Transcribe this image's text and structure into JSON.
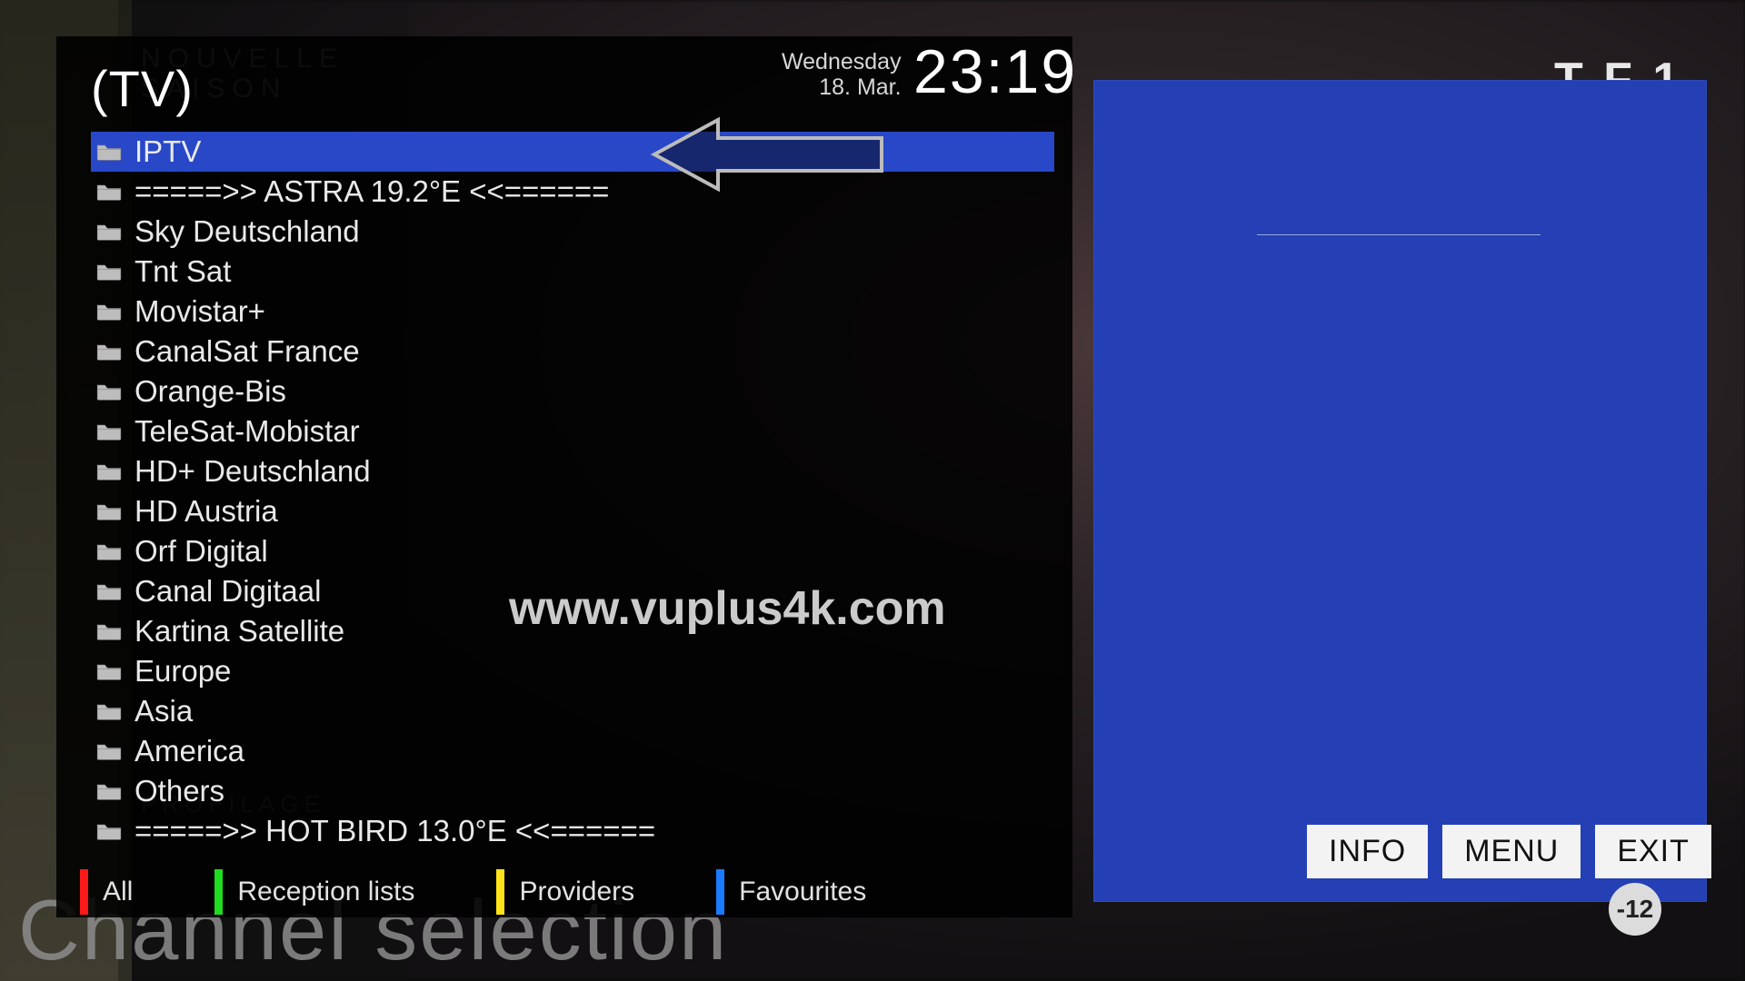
{
  "header": {
    "title": "(TV)",
    "weekday": "Wednesday",
    "date": "18. Mar.",
    "clock": "23:19"
  },
  "list": {
    "selected_index": 0,
    "items": [
      "IPTV",
      "=====>> ASTRA 19.2°E <<======",
      "Sky Deutschland",
      "Tnt Sat",
      "Movistar+",
      "CanalSat France",
      "Orange-Bis",
      "TeleSat-Mobistar",
      "HD+ Deutschland",
      "HD Austria",
      "Orf Digital",
      "Canal Digitaal",
      "Kartina Satellite",
      "Europe",
      "Asia",
      "America",
      "Others",
      "=====>> HOT BIRD 13.0°E <<======"
    ]
  },
  "color_keys": {
    "red": "All",
    "green": "Reception lists",
    "yellow": "Providers",
    "blue": "Favourites"
  },
  "buttons": {
    "info": "INFO",
    "menu": "MENU",
    "exit": "EXIT"
  },
  "logo": "T F 1",
  "age_badge": "-12",
  "background_promo": {
    "line1": "NOUVELLE",
    "line2": "SAISON",
    "show": "PROFILAGE"
  },
  "big_caption": "Channel selection",
  "watermark": "www.vuplus4k.com",
  "colors": {
    "selection": "#2848c8",
    "red": "#ff1a1a",
    "green": "#1fdc1f",
    "yellow": "#ffe11a",
    "blue": "#1a7bff"
  }
}
